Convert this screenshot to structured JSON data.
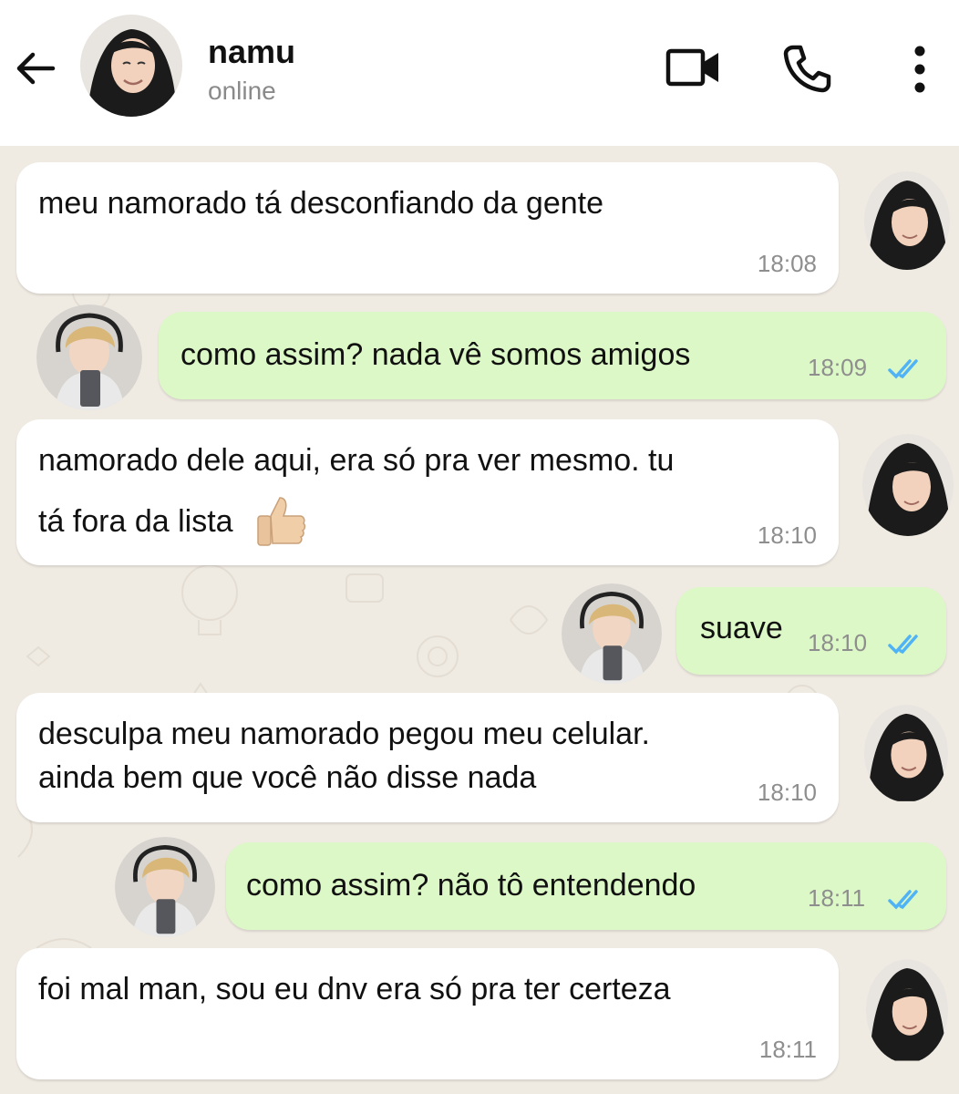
{
  "header": {
    "contact_name": "namu",
    "status": "online",
    "icons": [
      "back-arrow-icon",
      "video-call-icon",
      "phone-call-icon",
      "more-vert-icon"
    ]
  },
  "messages": [
    {
      "direction": "incoming",
      "text": "meu namorado tá desconfiando da gente",
      "time": "18:08"
    },
    {
      "direction": "outgoing",
      "text": "como assim? nada vê somos amigos",
      "time": "18:09",
      "status": "read"
    },
    {
      "direction": "incoming",
      "text_line1": "namorado dele aqui, era só pra ver mesmo. tu",
      "text_line2": "tá fora da lista",
      "emoji": "thumbs-up",
      "time": "18:10"
    },
    {
      "direction": "outgoing",
      "text": "suave",
      "time": "18:10",
      "status": "read"
    },
    {
      "direction": "incoming",
      "text_line1": "desculpa meu namorado pegou meu celular.",
      "text_line2": "ainda bem que você não disse nada",
      "time": "18:10"
    },
    {
      "direction": "outgoing",
      "text": "como assim? não tô entendendo",
      "time": "18:11",
      "status": "read"
    },
    {
      "direction": "incoming",
      "text": "foi mal man, sou eu dnv era só pra ter certeza",
      "time": "18:11"
    }
  ],
  "colors": {
    "incoming_bubble": "#ffffff",
    "outgoing_bubble": "#dcf8c6",
    "read_ticks": "#4fb3f6",
    "chat_background": "#efeae2"
  }
}
